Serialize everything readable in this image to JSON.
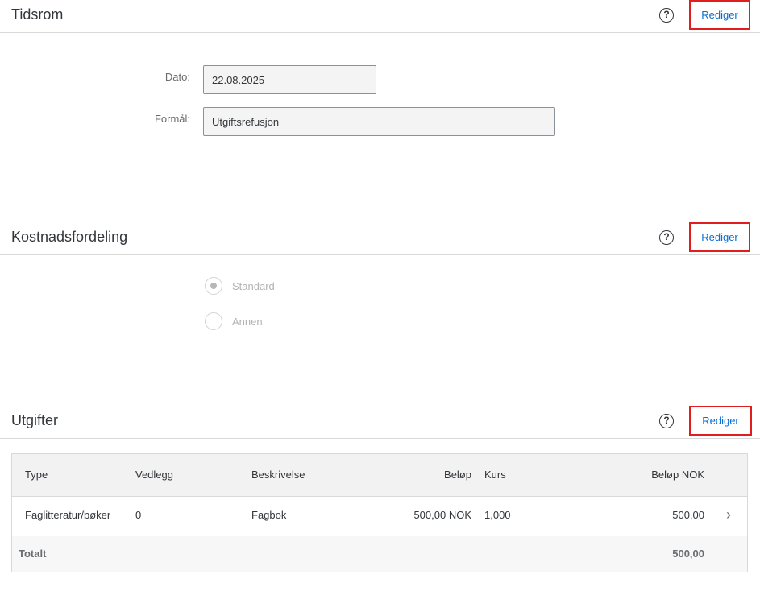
{
  "sections": {
    "tidsrom": {
      "title": "Tidsrom",
      "help": "?",
      "edit_label": "Rediger"
    },
    "kostnad": {
      "title": "Kostnadsfordeling",
      "help": "?",
      "edit_label": "Rediger"
    },
    "utgifter": {
      "title": "Utgifter",
      "help": "?",
      "edit_label": "Rediger"
    }
  },
  "form": {
    "date_label": "Dato:",
    "date_value": "22.08.2025",
    "purpose_label": "Formål:",
    "purpose_value": "Utgiftsrefusjon"
  },
  "distribution": {
    "options": [
      {
        "label": "Standard",
        "selected": true
      },
      {
        "label": "Annen",
        "selected": false
      }
    ]
  },
  "expenses": {
    "columns": [
      "Type",
      "Vedlegg",
      "Beskrivelse",
      "Beløp",
      "Kurs",
      "Beløp NOK"
    ],
    "rows": [
      {
        "type": "Faglitteratur/bøker",
        "attachments": "0",
        "description": "Fagbok",
        "amount": "500,00 NOK",
        "rate": "1,000",
        "amount_nok": "500,00"
      }
    ],
    "total_label": "Totalt",
    "total_value": "500,00"
  },
  "colors": {
    "accent": "#0a6ed1",
    "highlight": "#e01e1e"
  }
}
